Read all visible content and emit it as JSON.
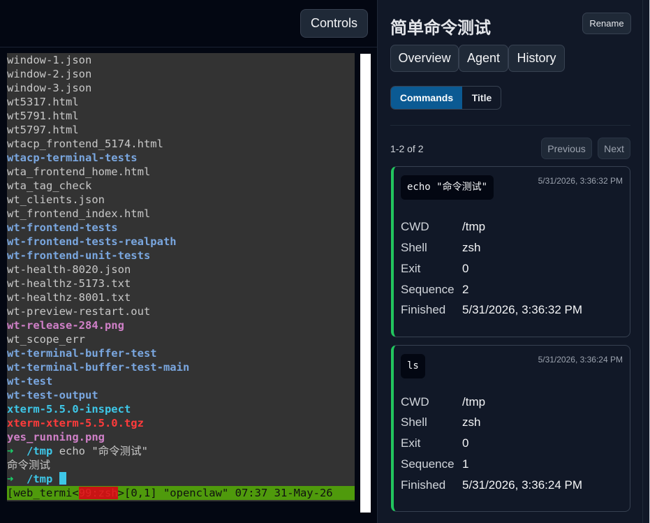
{
  "left": {
    "controls_label": "Controls",
    "terminal": {
      "lines": [
        {
          "text": "window-1.json",
          "kind": "file"
        },
        {
          "text": "window-2.json",
          "kind": "file"
        },
        {
          "text": "window-3.json",
          "kind": "file"
        },
        {
          "text": "wt5317.html",
          "kind": "file"
        },
        {
          "text": "wt5791.html",
          "kind": "file"
        },
        {
          "text": "wt5797.html",
          "kind": "file"
        },
        {
          "text": "wtacp_frontend_5174.html",
          "kind": "file"
        },
        {
          "text": "wtacp-terminal-tests",
          "kind": "dir"
        },
        {
          "text": "wta_frontend_home.html",
          "kind": "file"
        },
        {
          "text": "wta_tag_check",
          "kind": "file"
        },
        {
          "text": "wt_clients.json",
          "kind": "file"
        },
        {
          "text": "wt_frontend_index.html",
          "kind": "file"
        },
        {
          "text": "wt-frontend-tests",
          "kind": "dir"
        },
        {
          "text": "wt-frontend-tests-realpath",
          "kind": "dir"
        },
        {
          "text": "wt-frontend-unit-tests",
          "kind": "dir"
        },
        {
          "text": "wt-health-8020.json",
          "kind": "file"
        },
        {
          "text": "wt-healthz-5173.txt",
          "kind": "file"
        },
        {
          "text": "wt-healthz-8001.txt",
          "kind": "file"
        },
        {
          "text": "wt-preview-restart.out",
          "kind": "file"
        },
        {
          "text": "wt-release-284.png",
          "kind": "img"
        },
        {
          "text": "wt_scope_err",
          "kind": "file"
        },
        {
          "text": "wt-terminal-buffer-test",
          "kind": "dir"
        },
        {
          "text": "wt-terminal-buffer-test-main",
          "kind": "dir"
        },
        {
          "text": "wt-test",
          "kind": "dir"
        },
        {
          "text": "wt-test-output",
          "kind": "dir"
        },
        {
          "text": "xterm-5.5.0-inspect",
          "kind": "exe"
        },
        {
          "text": "xterm-xterm-5.5.0.tgz",
          "kind": "arc"
        },
        {
          "text": "yes_running.png",
          "kind": "img"
        }
      ],
      "prompt_arrow": "➜",
      "prompt_cwd": "/tmp",
      "prompt_command": "echo \"命令测试\"",
      "output_line": "命令测试",
      "prompt2_arrow": "➜",
      "prompt2_cwd": "/tmp",
      "status_left": "[web_termi<",
      "status_hl": "99:zsh",
      "status_right": ">[0,1] \"openclaw\" 07:37 31-May-26"
    }
  },
  "right": {
    "title": "简单命令测试",
    "rename_label": "Rename",
    "tabs": [
      "Overview",
      "Agent",
      "History"
    ],
    "segments": {
      "active": "Commands",
      "other": "Title"
    },
    "range_text": "1-2 of 2",
    "prev_label": "Previous",
    "next_label": "Next",
    "field_labels": {
      "cwd": "CWD",
      "shell": "Shell",
      "exit": "Exit",
      "sequence": "Sequence",
      "finished": "Finished"
    },
    "commands": [
      {
        "command": "echo \"命令测试\"",
        "timestamp": "5/31/2026, 3:36:32 PM",
        "cwd": "/tmp",
        "shell": "zsh",
        "exit": "0",
        "sequence": "2",
        "finished": "5/31/2026, 3:36:32 PM"
      },
      {
        "command": "ls",
        "timestamp": "5/31/2026, 3:36:24 PM",
        "cwd": "/tmp",
        "shell": "zsh",
        "exit": "0",
        "sequence": "1",
        "finished": "5/31/2026, 3:36:24 PM"
      }
    ],
    "colors": {
      "accent_blue": "#0b5a93",
      "card_accent_green": "#22c55e",
      "status_bar_green": "#4f9a0c"
    }
  }
}
